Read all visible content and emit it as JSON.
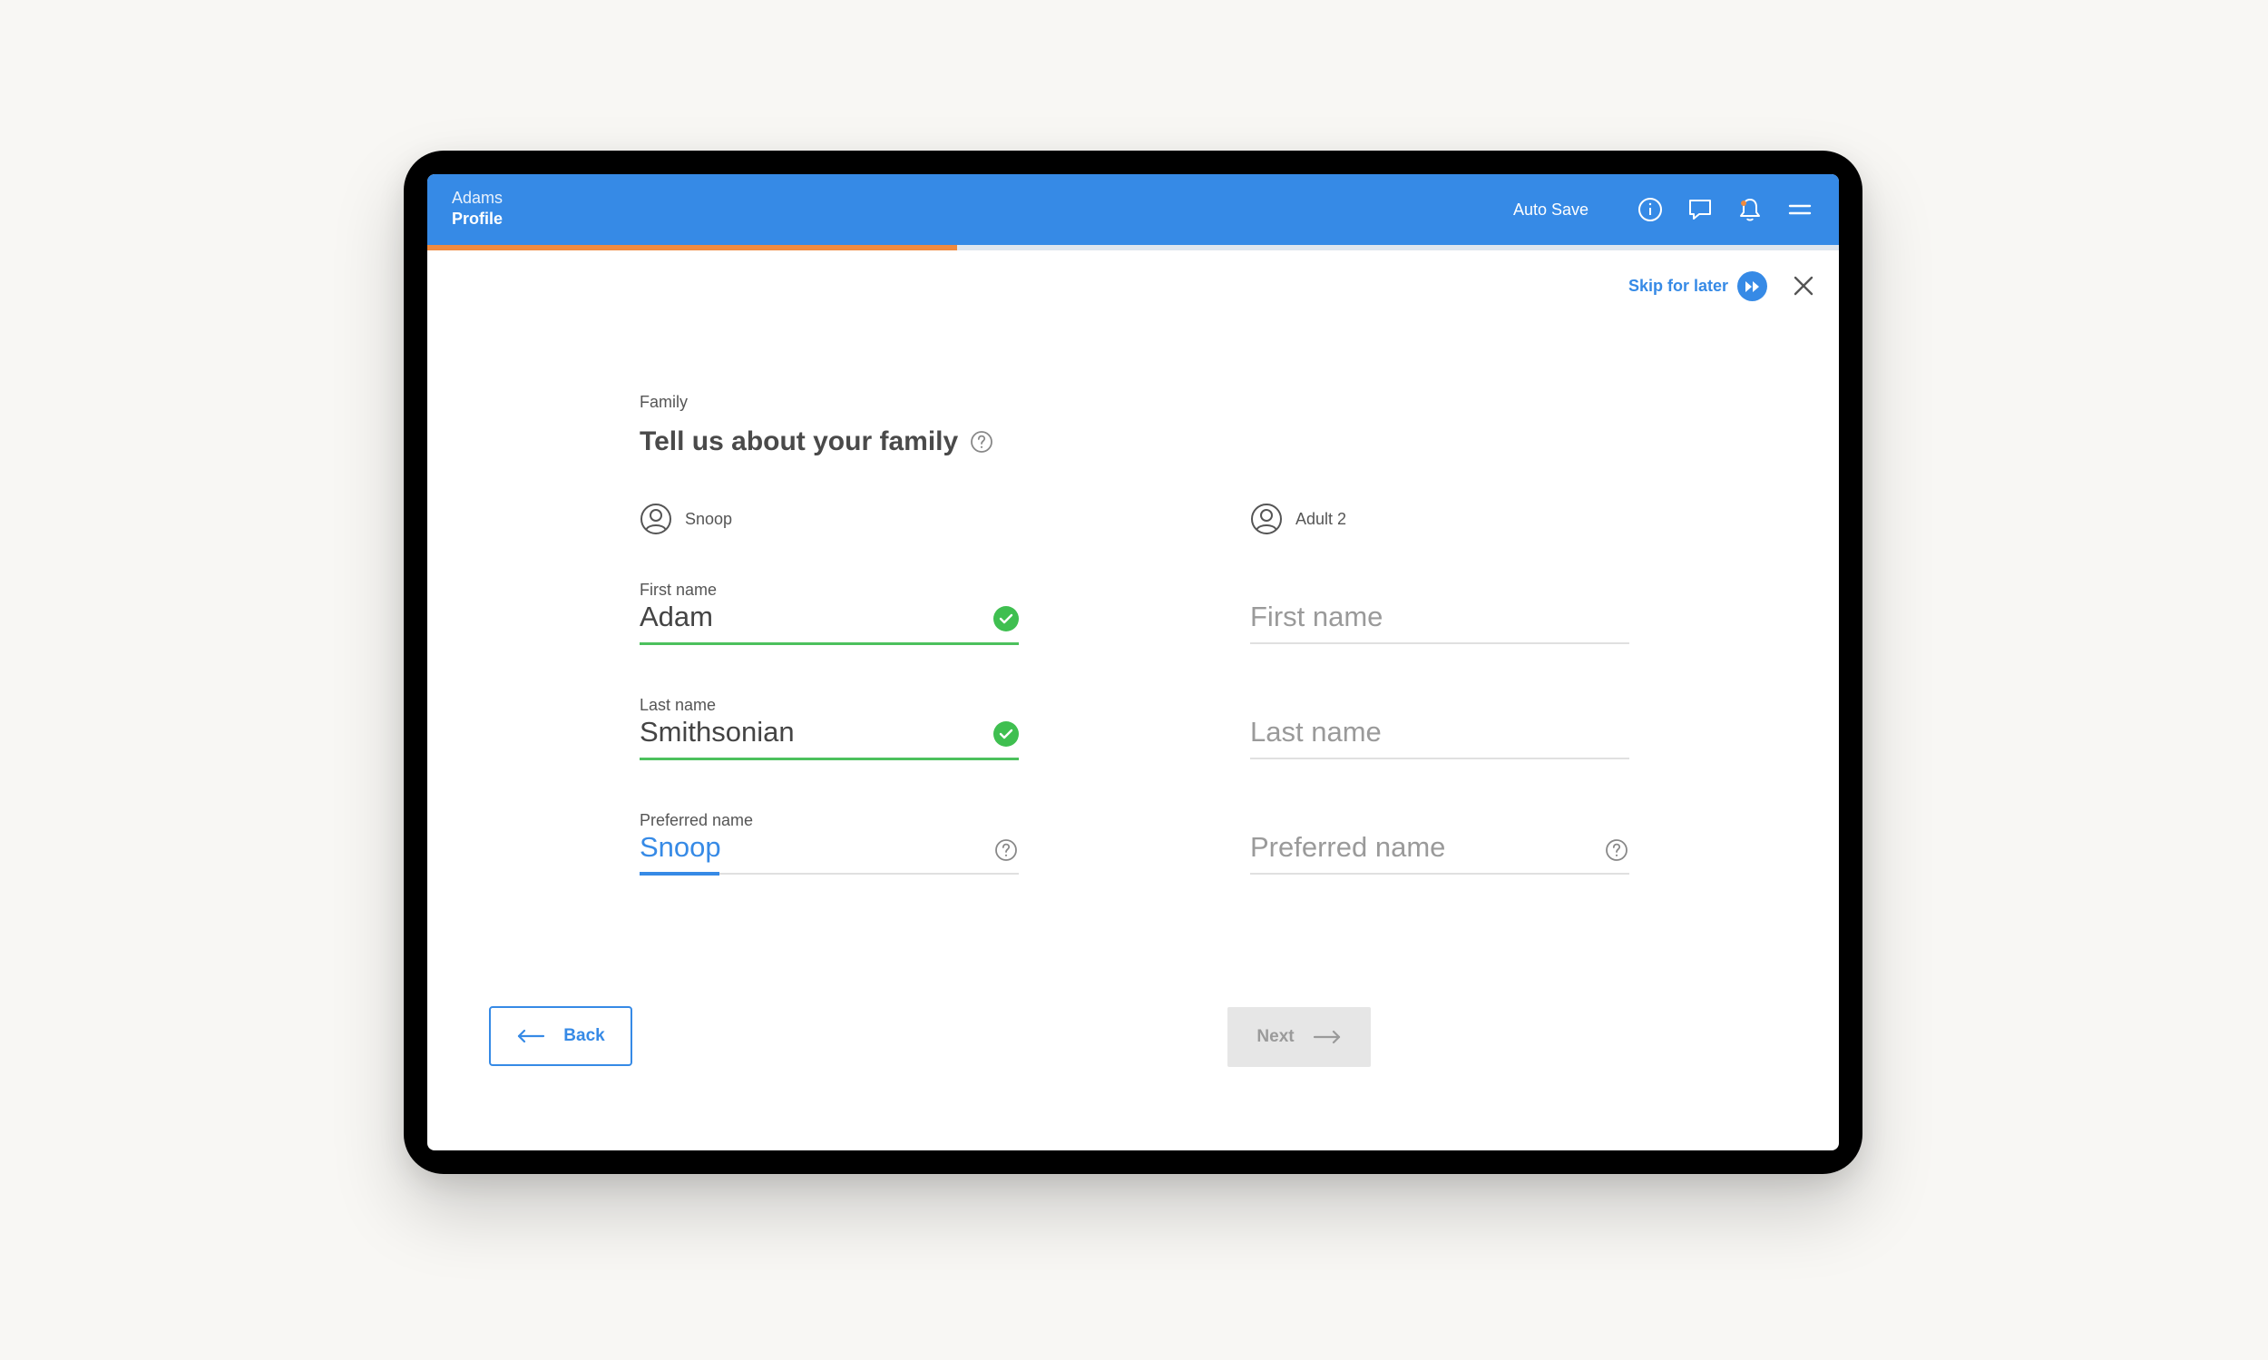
{
  "header": {
    "app_name": "Adams",
    "section": "Profile",
    "autosave_label": "Auto Save",
    "icons": [
      "info-icon",
      "chat-icon",
      "bell-icon",
      "menu-icon"
    ]
  },
  "progress": {
    "percent": 37.5,
    "fill_color": "#f08a3e"
  },
  "skip": {
    "label": "Skip for later"
  },
  "form": {
    "section_label": "Family",
    "title": "Tell us about your family",
    "adult1": {
      "name": "Snoop",
      "first_name_label": "First name",
      "first_name_value": "Adam",
      "last_name_label": "Last name",
      "last_name_value": "Smithsonian",
      "preferred_name_label": "Preferred name",
      "preferred_name_value": "Snoop"
    },
    "adult2": {
      "name": "Adult 2",
      "first_name_placeholder": "First name",
      "last_name_placeholder": "Last name",
      "preferred_name_placeholder": "Preferred name"
    }
  },
  "nav": {
    "back_label": "Back",
    "next_label": "Next"
  },
  "colors": {
    "brand": "#368ae6",
    "valid": "#3fbf50",
    "progress": "#f08a3e",
    "disabled": "#e6e6e6"
  }
}
